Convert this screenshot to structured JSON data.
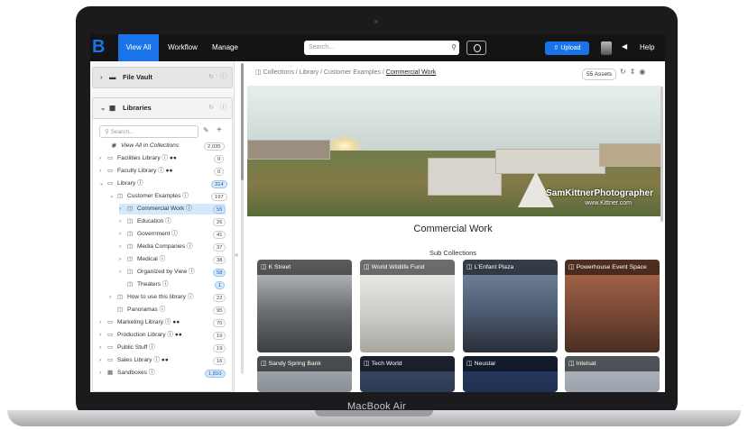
{
  "device": {
    "label": "MacBook Air"
  },
  "topbar": {
    "logo": "B",
    "nav": [
      {
        "label": "View All",
        "active": true
      },
      {
        "label": "Workflow",
        "active": false
      },
      {
        "label": "Manage",
        "active": false
      }
    ],
    "search_placeholder": "Search...",
    "upload_label": "Upload",
    "help_label": "Help"
  },
  "sidebar": {
    "file_vault": {
      "label": "File Vault"
    },
    "libraries": {
      "label": "Libraries",
      "search_placeholder": "Search..."
    },
    "tree": [
      {
        "label": "View All in Collections",
        "count": "2,035",
        "italic": true
      },
      {
        "label": "Facilities Library",
        "count": "0"
      },
      {
        "label": "Faculty Library",
        "count": "0"
      },
      {
        "label": "Library",
        "count": "314",
        "blue": true
      },
      {
        "label": "Customer Examples",
        "count": "197"
      },
      {
        "label": "Commercial Work",
        "count": "55",
        "selected": true,
        "blue": true
      },
      {
        "label": "Education",
        "count": "26"
      },
      {
        "label": "Government",
        "count": "41"
      },
      {
        "label": "Media Companies",
        "count": "37"
      },
      {
        "label": "Medical",
        "count": "38"
      },
      {
        "label": "Organized by View",
        "count": "58",
        "blue": true
      },
      {
        "label": "Theaters",
        "count": "1",
        "blue": true
      },
      {
        "label": "How to use this library",
        "count": "22"
      },
      {
        "label": "Panoramas",
        "count": "95"
      },
      {
        "label": "Marketing Library",
        "count": "70"
      },
      {
        "label": "Production Library",
        "count": "19"
      },
      {
        "label": "Public Stuff",
        "count": "19"
      },
      {
        "label": "Sales Library",
        "count": "16"
      },
      {
        "label": "Sandboxes",
        "count": "1,810",
        "blue": true
      }
    ]
  },
  "main": {
    "breadcrumb": [
      "Collections",
      "Library",
      "Customer Examples",
      "Commercial Work"
    ],
    "assets_label": "55 Assets",
    "hero_watermark": "SamKittnerPhotographer",
    "hero_watermark_url": "www.Kittner.com",
    "collection_title": "Commercial Work",
    "subcollections_label": "Sub Collections",
    "subcollections": [
      {
        "label": "K Street",
        "bg": "#6b6f74"
      },
      {
        "label": "World Wildlife Fund",
        "bg": "#c9ccc8"
      },
      {
        "label": "L'Enfant Plaza",
        "bg": "#4d5d74"
      },
      {
        "label": "Powerhouse Event Space",
        "bg": "#7b4a37"
      },
      {
        "label": "Sandy Spring Bank",
        "bg": "#8a9098"
      },
      {
        "label": "Tech World",
        "bg": "#2d3a52"
      },
      {
        "label": "Neustar",
        "bg": "#1f3050"
      },
      {
        "label": "Intelsat",
        "bg": "#9aa2ac"
      }
    ]
  }
}
